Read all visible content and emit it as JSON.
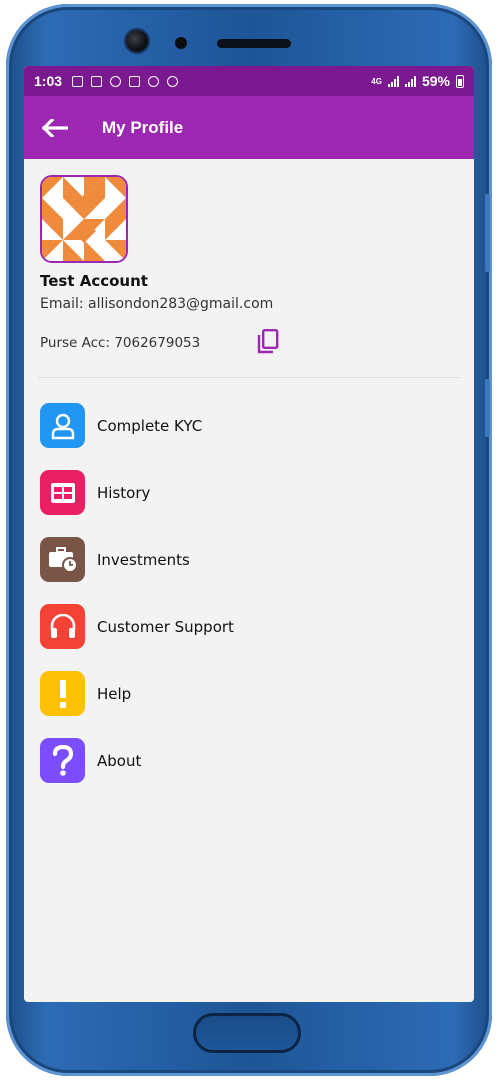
{
  "status_bar": {
    "time": "1:03",
    "network": "4G",
    "battery": "59%"
  },
  "app_bar": {
    "title": "My Profile",
    "back_icon": "arrow-left-icon"
  },
  "profile": {
    "avatar_colors": [
      "#f08a3c",
      "#ffffff"
    ],
    "name": "Test Account",
    "email": "Email: allisondon283@gmail.com",
    "purse": "Purse Acc: 7062679053",
    "copy_icon": "copy-icon"
  },
  "menu": {
    "items": [
      {
        "label": "Complete KYC",
        "icon": "person-icon",
        "color": "#2196f3"
      },
      {
        "label": "History",
        "icon": "table-icon",
        "color": "#e91e63"
      },
      {
        "label": "Investments",
        "icon": "briefcase-clock-icon",
        "color": "#795548"
      },
      {
        "label": "Customer Support",
        "icon": "headset-icon",
        "color": "#f44336"
      },
      {
        "label": "Help",
        "icon": "exclamation-icon",
        "color": "#ffc107"
      },
      {
        "label": "About",
        "icon": "question-icon",
        "color": "#7c4dff"
      }
    ]
  },
  "colors": {
    "app_bar": "#9c27b0",
    "status_bar": "#7b1990",
    "phone_body": "#1e5596"
  }
}
